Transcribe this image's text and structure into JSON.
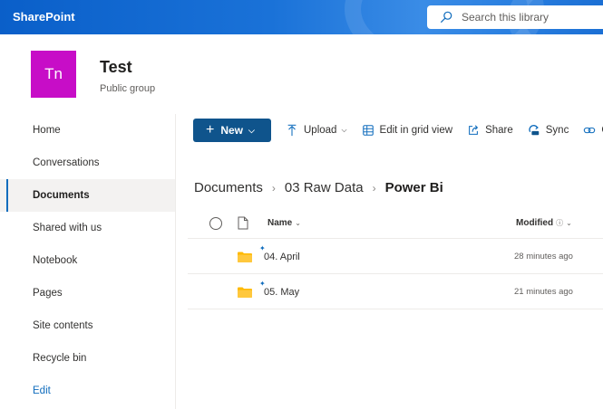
{
  "suite": {
    "brand": "SharePoint",
    "search_placeholder": "Search this library"
  },
  "site": {
    "logo_initials": "Tn",
    "title": "Test",
    "subtitle": "Public group"
  },
  "leftnav": {
    "items": [
      {
        "label": "Home"
      },
      {
        "label": "Conversations"
      },
      {
        "label": "Documents",
        "active": true
      },
      {
        "label": "Shared with us"
      },
      {
        "label": "Notebook"
      },
      {
        "label": "Pages"
      },
      {
        "label": "Site contents"
      },
      {
        "label": "Recycle bin"
      },
      {
        "label": "Edit"
      }
    ]
  },
  "commandbar": {
    "new": "New",
    "upload": "Upload",
    "edit_grid": "Edit in grid view",
    "share": "Share",
    "sync": "Sync",
    "copy_link": "C"
  },
  "breadcrumb": {
    "items": [
      "Documents",
      "03 Raw Data"
    ],
    "current": "Power Bi"
  },
  "list": {
    "columns": {
      "name": "Name",
      "modified": "Modified"
    },
    "rows": [
      {
        "name": "04. April",
        "modified": "28 minutes ago"
      },
      {
        "name": "05. May",
        "modified": "21 minutes ago"
      }
    ]
  },
  "colors": {
    "brand_bar": "#1a72d8",
    "new_button": "#0f548c",
    "site_logo": "#c70dc7",
    "folder": "#ffb900"
  }
}
